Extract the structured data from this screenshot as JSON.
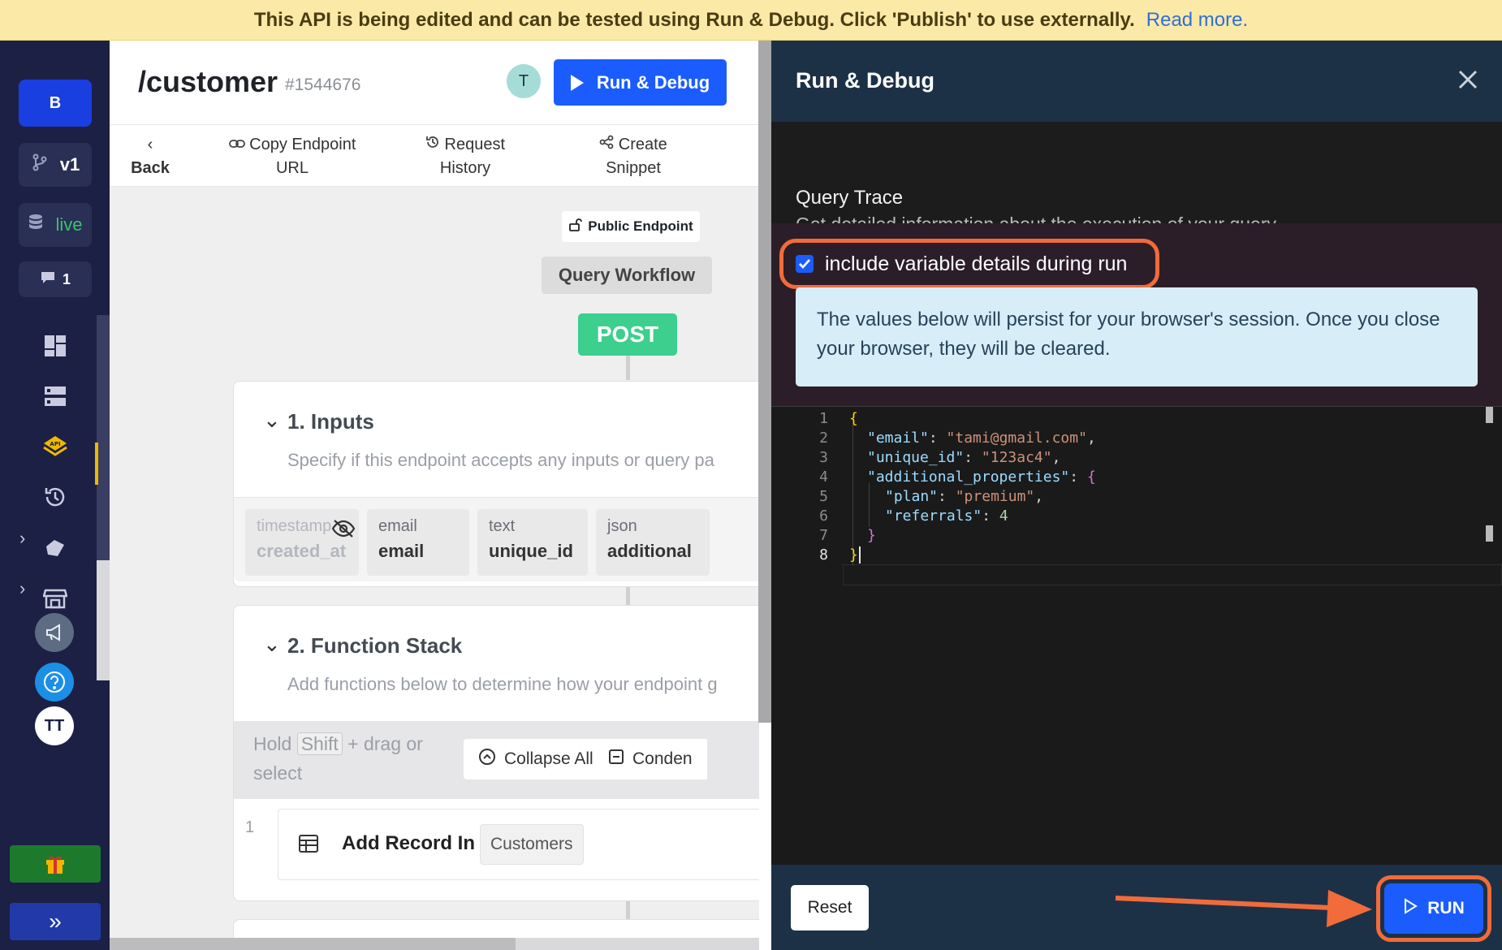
{
  "banner": {
    "message": "This API is being edited and can be tested using Run & Debug. Click 'Publish' to use externally.",
    "link": "Read more."
  },
  "leftnav": {
    "workspace_initial": "B",
    "branch": "v1",
    "environment": "live",
    "comments_count": "1",
    "user_initials": "TT"
  },
  "main": {
    "title": "/customer",
    "id": "#1544676",
    "avatar": "T",
    "run_debug_label": "Run & Debug",
    "toolbar": [
      {
        "line1": "Back",
        "line2": ""
      },
      {
        "line1": "Copy Endpoint",
        "line2": "URL"
      },
      {
        "line1": "Request",
        "line2": "History"
      },
      {
        "line1": "Create",
        "line2": "Snippet"
      }
    ],
    "public_endpoint": "Public Endpoint",
    "workflow": "Query Workflow",
    "method": "POST",
    "inputs": {
      "title": "1. Inputs",
      "description": "Specify if this endpoint accepts any inputs or query pa",
      "fields": [
        {
          "type": "timestamp",
          "name": "created_at"
        },
        {
          "type": "email",
          "name": "email"
        },
        {
          "type": "text",
          "name": "unique_id"
        },
        {
          "type": "json",
          "name": "additional"
        }
      ]
    },
    "function_stack": {
      "title": "2. Function Stack",
      "description": "Add functions below to determine how your endpoint g",
      "hint_pre": "Hold",
      "hint_key": "Shift",
      "hint_post": "+ drag or select",
      "collapse_all": "Collapse All",
      "condense": "Conden",
      "row_number": "1",
      "row_label": "Add Record In",
      "row_tag": "Customers"
    }
  },
  "panel": {
    "title": "Run & Debug",
    "query_trace_title": "Query Trace",
    "query_trace_desc": "Get detailed information about the execution of your query",
    "checkbox_label": "include variable details during run",
    "checkbox_checked": true,
    "info": "The values below will persist for your browser's session. Once you close your browser, they will be cleared.",
    "code": {
      "line_numbers": [
        "1",
        "2",
        "3",
        "4",
        "5",
        "6",
        "7",
        "8"
      ],
      "l1": "{",
      "l2_key": "\"email\"",
      "l2_val": "\"tami@gmail.com\"",
      "l3_key": "\"unique_id\"",
      "l3_val": "\"123ac4\"",
      "l4_key": "\"additional_properties\"",
      "l4_open": "{",
      "l5_key": "\"plan\"",
      "l5_val": "\"premium\"",
      "l6_key": "\"referrals\"",
      "l6_val": "4",
      "l7": "}",
      "l8": "}"
    },
    "reset_label": "Reset",
    "run_label": "RUN"
  },
  "colors": {
    "accent_blue": "#1b5cff",
    "highlight_orange": "#f26b3a",
    "post_green": "#3ccf8e",
    "nav_bg": "#1c2045"
  }
}
